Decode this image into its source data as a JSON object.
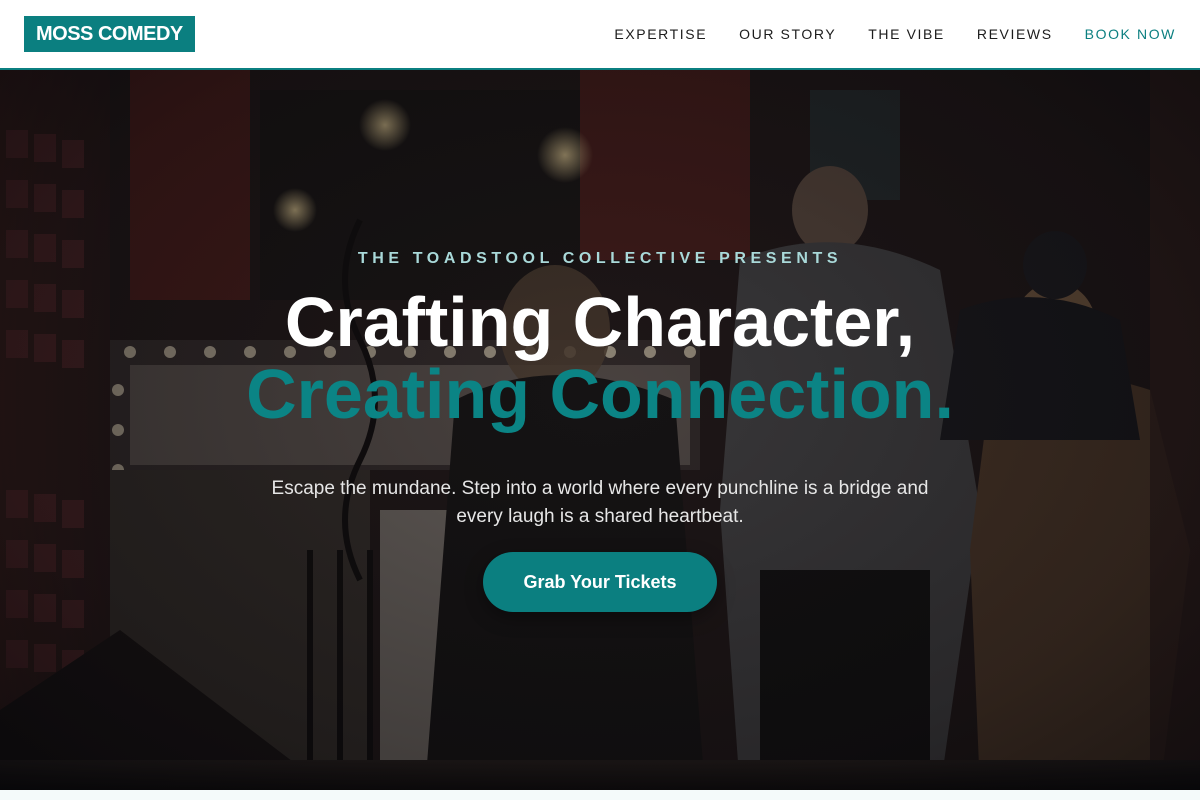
{
  "brand": {
    "logo_text": "MOSS COMEDY",
    "accent_color": "#0b7f80"
  },
  "nav": {
    "items": [
      {
        "label": "EXPERTISE"
      },
      {
        "label": "OUR STORY"
      },
      {
        "label": "THE VIBE"
      },
      {
        "label": "REVIEWS"
      }
    ],
    "cta_label": "BOOK NOW"
  },
  "hero": {
    "eyebrow": "THE TOADSTOOL COLLECTIVE PRESENTS",
    "headline_line1": "Crafting Character,",
    "headline_line2": "Creating Connection.",
    "subtext": "Escape the mundane. Step into a world where every punchline is a bridge and every laugh is a shared heartbeat.",
    "cta_label": "Grab Your Tickets",
    "background_image": "comedy club staircase with audience members"
  }
}
